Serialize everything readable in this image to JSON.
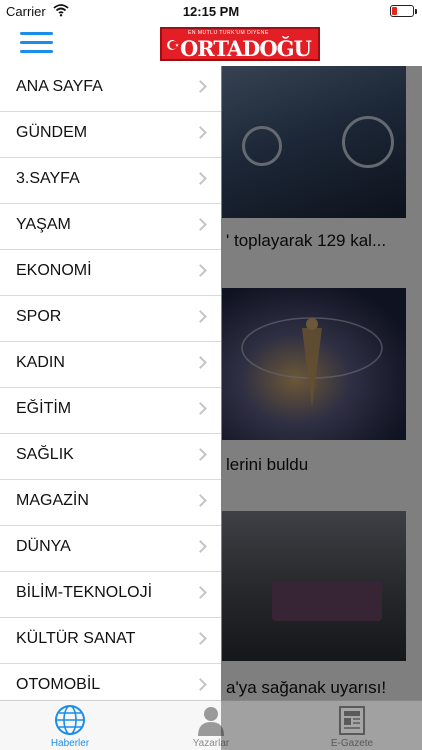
{
  "status_bar": {
    "carrier": "Carrier",
    "time": "12:15 PM",
    "battery_level": 0.2,
    "wifi_icon": "wifi-icon"
  },
  "header": {
    "logo_tagline": "EN MUTLU TÜRK'ÜM DİYENE",
    "logo_text": "ORTADOĞU",
    "menu_icon": "hamburger-icon"
  },
  "menu": {
    "items": [
      {
        "label": "ANA SAYFA"
      },
      {
        "label": "GÜNDEM"
      },
      {
        "label": "3.SAYFA"
      },
      {
        "label": "YAŞAM"
      },
      {
        "label": "EKONOMİ"
      },
      {
        "label": "SPOR"
      },
      {
        "label": "KADIN"
      },
      {
        "label": "EĞİTİM"
      },
      {
        "label": "SAĞLIK"
      },
      {
        "label": "MAGAZİN"
      },
      {
        "label": "DÜNYA"
      },
      {
        "label": "BİLİM-TEKNOLOJİ"
      },
      {
        "label": "KÜLTÜR SANAT"
      },
      {
        "label": "OTOMOBİL"
      }
    ]
  },
  "feed": {
    "headlines": [
      "' toplayarak 129 kal...",
      "lerini buldu",
      "a'ya sağanak uyarısı!"
    ]
  },
  "tabbar": {
    "tabs": [
      {
        "label": "Haberler",
        "icon": "globe-icon",
        "active": true
      },
      {
        "label": "Yazarlar",
        "icon": "person-icon",
        "active": false
      },
      {
        "label": "E-Gazete",
        "icon": "newspaper-icon",
        "active": false
      }
    ]
  },
  "colors": {
    "accent": "#1a8ee8",
    "logo_red": "#e31e24",
    "battery_low": "#e2271d"
  }
}
